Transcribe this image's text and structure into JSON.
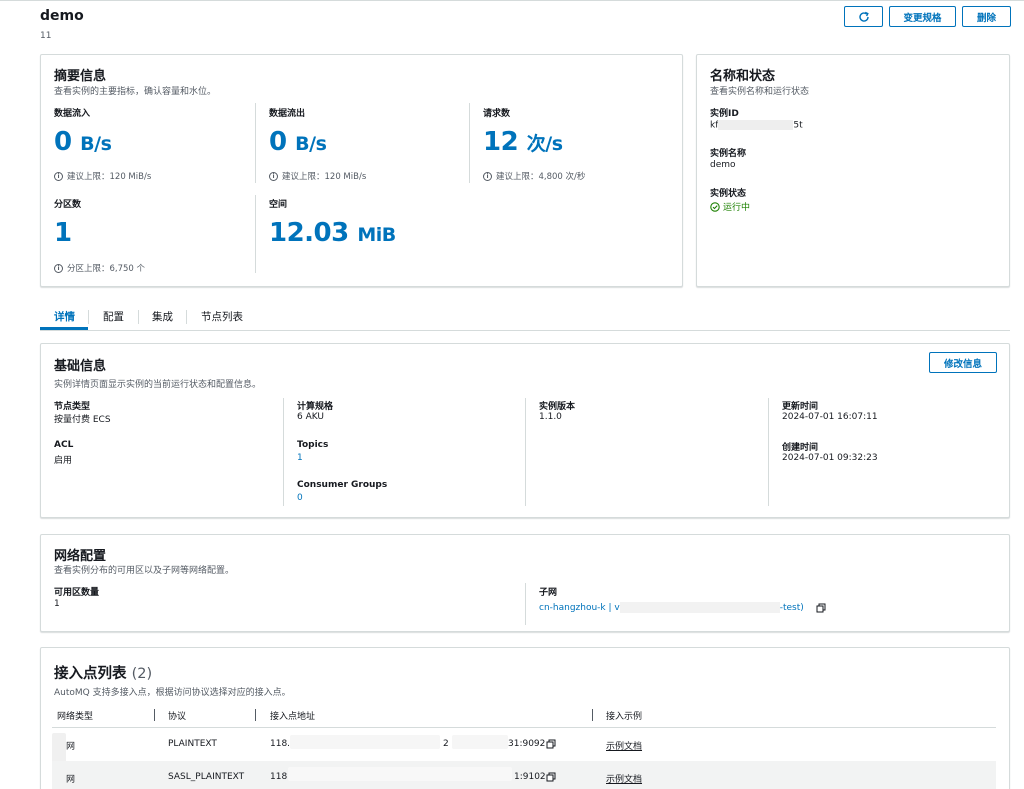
{
  "header": {
    "title": "demo",
    "sub": "11",
    "refresh_icon": "refresh-icon",
    "change_spec_label": "变更规格",
    "delete_label": "删除"
  },
  "summary": {
    "title": "摘要信息",
    "desc": "查看实例的主要指标，确认容量和水位。",
    "metrics": [
      {
        "label": "数据流入",
        "value": "0",
        "unit": "B/s",
        "hint": "建议上限：120 MiB/s"
      },
      {
        "label": "数据流出",
        "value": "0",
        "unit": "B/s",
        "hint": "建议上限：120 MiB/s"
      },
      {
        "label": "请求数",
        "value": "12",
        "unit": "次/s",
        "hint": "建议上限：4,800 次/秒"
      },
      {
        "label": "分区数",
        "value": "1",
        "unit": "",
        "hint": "分区上限：6,750 个"
      },
      {
        "label": "空间",
        "value": "12.03",
        "unit": "MiB",
        "hint": ""
      }
    ]
  },
  "status": {
    "title": "名称和状态",
    "desc": "查看实例名称和运行状态",
    "id_label": "实例ID",
    "id_value_prefix": "kf",
    "id_value_suffix": "5t",
    "name_label": "实例名称",
    "name_value": "demo",
    "state_label": "实例状态",
    "state_value": "运行中",
    "state_color": "#1d8102"
  },
  "tabs": [
    "详情",
    "配置",
    "集成",
    "节点列表"
  ],
  "basic": {
    "title": "基础信息",
    "desc": "实例详情页面显示实例的当前运行状态和配置信息。",
    "edit_label": "修改信息",
    "node_type_label": "节点类型",
    "node_type_value": "按量付费 ECS",
    "acl_label": "ACL",
    "acl_value": "启用",
    "spec_label": "计算规格",
    "spec_value": "6 AKU",
    "topics_label": "Topics",
    "topics_value": "1",
    "cg_label": "Consumer Groups",
    "cg_value": "0",
    "version_label": "实例版本",
    "version_value": "1.1.0",
    "updated_label": "更新时间",
    "updated_value": "2024-07-01 16:07:11",
    "created_label": "创建时间",
    "created_value": "2024-07-01 09:32:23"
  },
  "network": {
    "title": "网络配置",
    "desc": "查看实例分布的可用区以及子网等网络配置。",
    "az_label": "可用区数量",
    "az_value": "1",
    "subnet_label": "子网",
    "subnet_prefix": "cn-hangzhou-k | v",
    "subnet_suffix": "-test)"
  },
  "endpoints": {
    "title": "接入点列表",
    "count": "(2)",
    "desc": "AutoMQ 支持多接入点，根据访问协议选择对应的接入点。",
    "columns": [
      "网络类型",
      "协议",
      "接入点地址",
      "接入示例"
    ],
    "rows": [
      {
        "network": "网",
        "protocol": "PLAINTEXT",
        "addr_prefix": "118.",
        "addr_mid": "2",
        "addr_suffix": "31:9092",
        "example": "示例文档"
      },
      {
        "network": "网",
        "protocol": "SASL_PLAINTEXT",
        "addr_prefix": "118",
        "addr_mid": "",
        "addr_suffix": "1:9102",
        "example": "示例文档"
      }
    ]
  },
  "colors": {
    "accent": "#0073bb",
    "border": "#d5dbdb",
    "text": "#16191f",
    "muted": "#545b64"
  }
}
